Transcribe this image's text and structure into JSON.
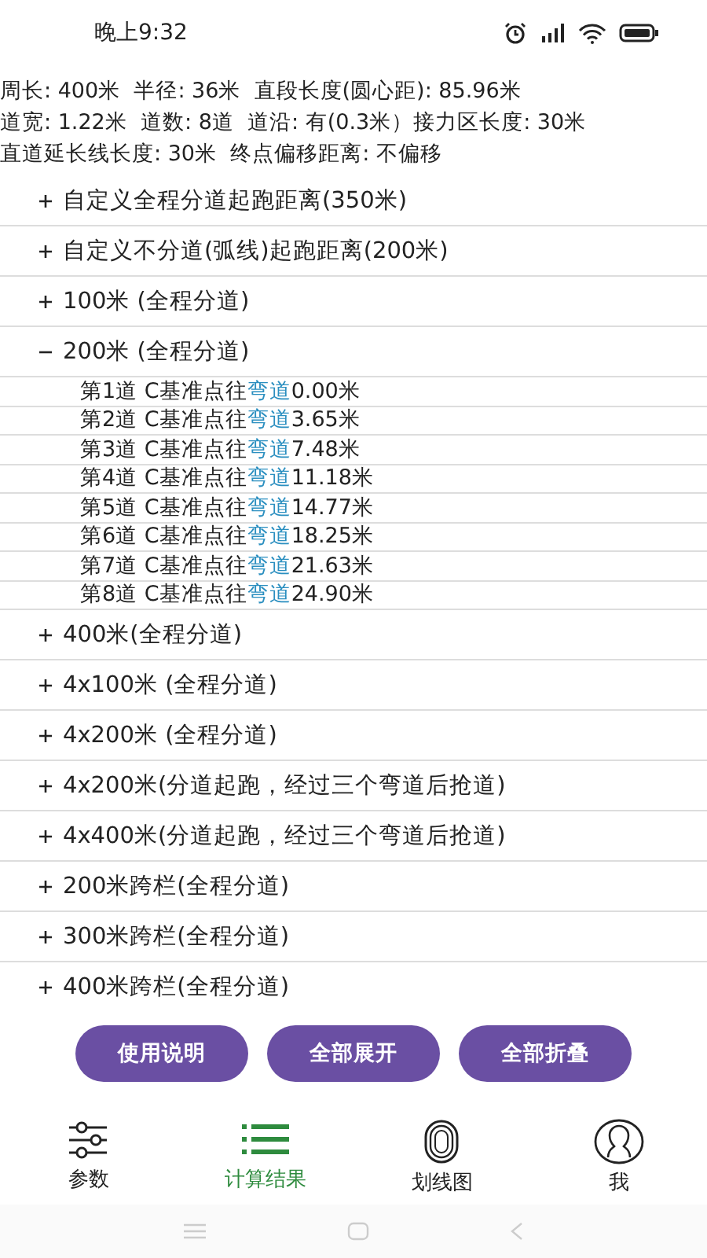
{
  "status_bar": {
    "time": "晚上9:32"
  },
  "summary": [
    "周长: 400米  半径: 36米  直段长度(圆心距): 85.96米",
    "道宽: 1.22米  道数: 8道  道沿: 有(0.3米）接力区长度: 30米",
    "直道延长线长度: 30米  终点偏移距离: 不偏移"
  ],
  "groups": [
    {
      "label": "自定义全程分道起跑距离(350米)",
      "expanded": false
    },
    {
      "label": "自定义不分道(弧线)起跑距离(200米)",
      "expanded": false
    },
    {
      "label": "100米 (全程分道)",
      "expanded": false
    },
    {
      "label": "200米 (全程分道)",
      "expanded": true,
      "children": [
        {
          "prefix": "第1道 C基准点往",
          "highlight": "弯道",
          "value": "0.00米"
        },
        {
          "prefix": "第2道 C基准点往",
          "highlight": "弯道",
          "value": "3.65米"
        },
        {
          "prefix": "第3道 C基准点往",
          "highlight": "弯道",
          "value": "7.48米"
        },
        {
          "prefix": "第4道 C基准点往",
          "highlight": "弯道",
          "value": "11.18米"
        },
        {
          "prefix": "第5道 C基准点往",
          "highlight": "弯道",
          "value": "14.77米"
        },
        {
          "prefix": "第6道 C基准点往",
          "highlight": "弯道",
          "value": "18.25米"
        },
        {
          "prefix": "第7道 C基准点往",
          "highlight": "弯道",
          "value": "21.63米"
        },
        {
          "prefix": "第8道 C基准点往",
          "highlight": "弯道",
          "value": "24.90米"
        }
      ]
    },
    {
      "label": "400米(全程分道)",
      "expanded": false
    },
    {
      "label": "4x100米 (全程分道)",
      "expanded": false
    },
    {
      "label": "4x200米 (全程分道)",
      "expanded": false
    },
    {
      "label": "4x200米(分道起跑，经过三个弯道后抢道)",
      "expanded": false
    },
    {
      "label": "4x400米(分道起跑，经过三个弯道后抢道)",
      "expanded": false
    },
    {
      "label": "200米跨栏(全程分道)",
      "expanded": false
    },
    {
      "label": "300米跨栏(全程分道)",
      "expanded": false
    },
    {
      "label": "400米跨栏(全程分道)",
      "expanded": false
    }
  ],
  "buttons": [
    "使用说明",
    "全部展开",
    "全部折叠"
  ],
  "nav": [
    {
      "label": "参数",
      "kind": "sliders",
      "selected": false
    },
    {
      "label": "计算结果",
      "kind": "list",
      "selected": true
    },
    {
      "label": "划线图",
      "kind": "track",
      "selected": false
    },
    {
      "label": "我",
      "kind": "profile",
      "selected": false
    }
  ]
}
